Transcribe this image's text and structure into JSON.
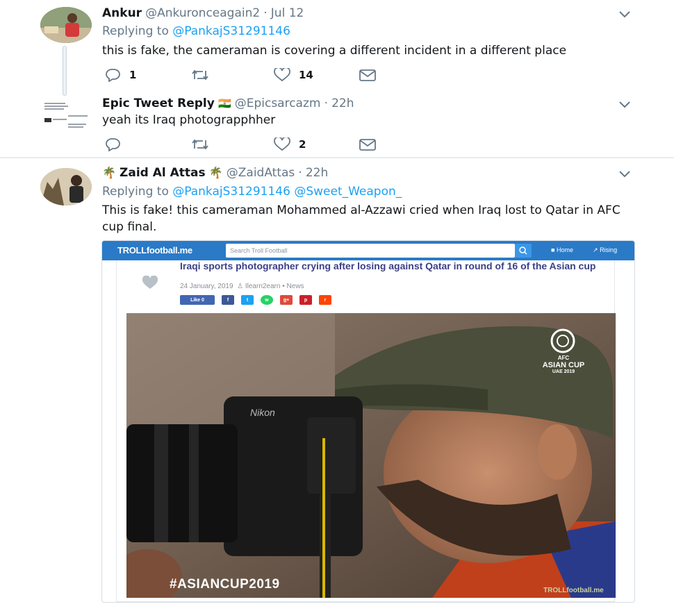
{
  "tweets": [
    {
      "name": "Ankur",
      "handle": "@Ankuronceagain2",
      "time": "Jul 12",
      "replying_prefix": "Replying to",
      "replying_to": "@PankajS31291146",
      "text": "this is fake, the cameraman is covering a different incident in a different place",
      "replies": "1",
      "retweets": "",
      "likes": "14"
    },
    {
      "name": "Epic Tweet Reply",
      "flag": "🇮🇳",
      "handle": "@Epicsarcazm",
      "time": "22h",
      "text": "yeah its Iraq photograpphher",
      "replies": "",
      "retweets": "",
      "likes": "2"
    },
    {
      "name_prefix": "🌴",
      "name": "Zaid Al Attas",
      "name_suffix": "🌴",
      "handle": "@ZaidAttas",
      "time": "22h",
      "replying_prefix": "Replying to",
      "replying_to": "@PankajS31291146 @Sweet_Weapon_",
      "text": "This is fake! this cameraman Mohammed al-Azzawi cried when Iraq lost to Qatar in AFC cup final."
    }
  ],
  "separator_dot": "·",
  "card": {
    "site_name": "TROLLfootball.me",
    "search_placeholder": "Search Troll Football",
    "nav_home": "Home",
    "nav_rising": "Rising",
    "article_title": "Iraqi sports photographer crying after losing against Qatar in round of 16 of the Asian cup",
    "article_date": "24 January, 2019",
    "article_author": "Ilearn2earn",
    "article_category": "News",
    "like_label": "Like 0",
    "photo_hashtag": "#ASIANCUP2019",
    "photo_logo_line1": "AFC",
    "photo_logo_line2": "ASIAN CUP",
    "photo_logo_line3": "UAE 2019",
    "photo_watermark": "TROLLfootball.me",
    "camera_brand": "Nikon"
  },
  "colors": {
    "link_blue": "#1da1f2",
    "muted_gray": "#657786",
    "site_blue": "#2a7ac7"
  }
}
